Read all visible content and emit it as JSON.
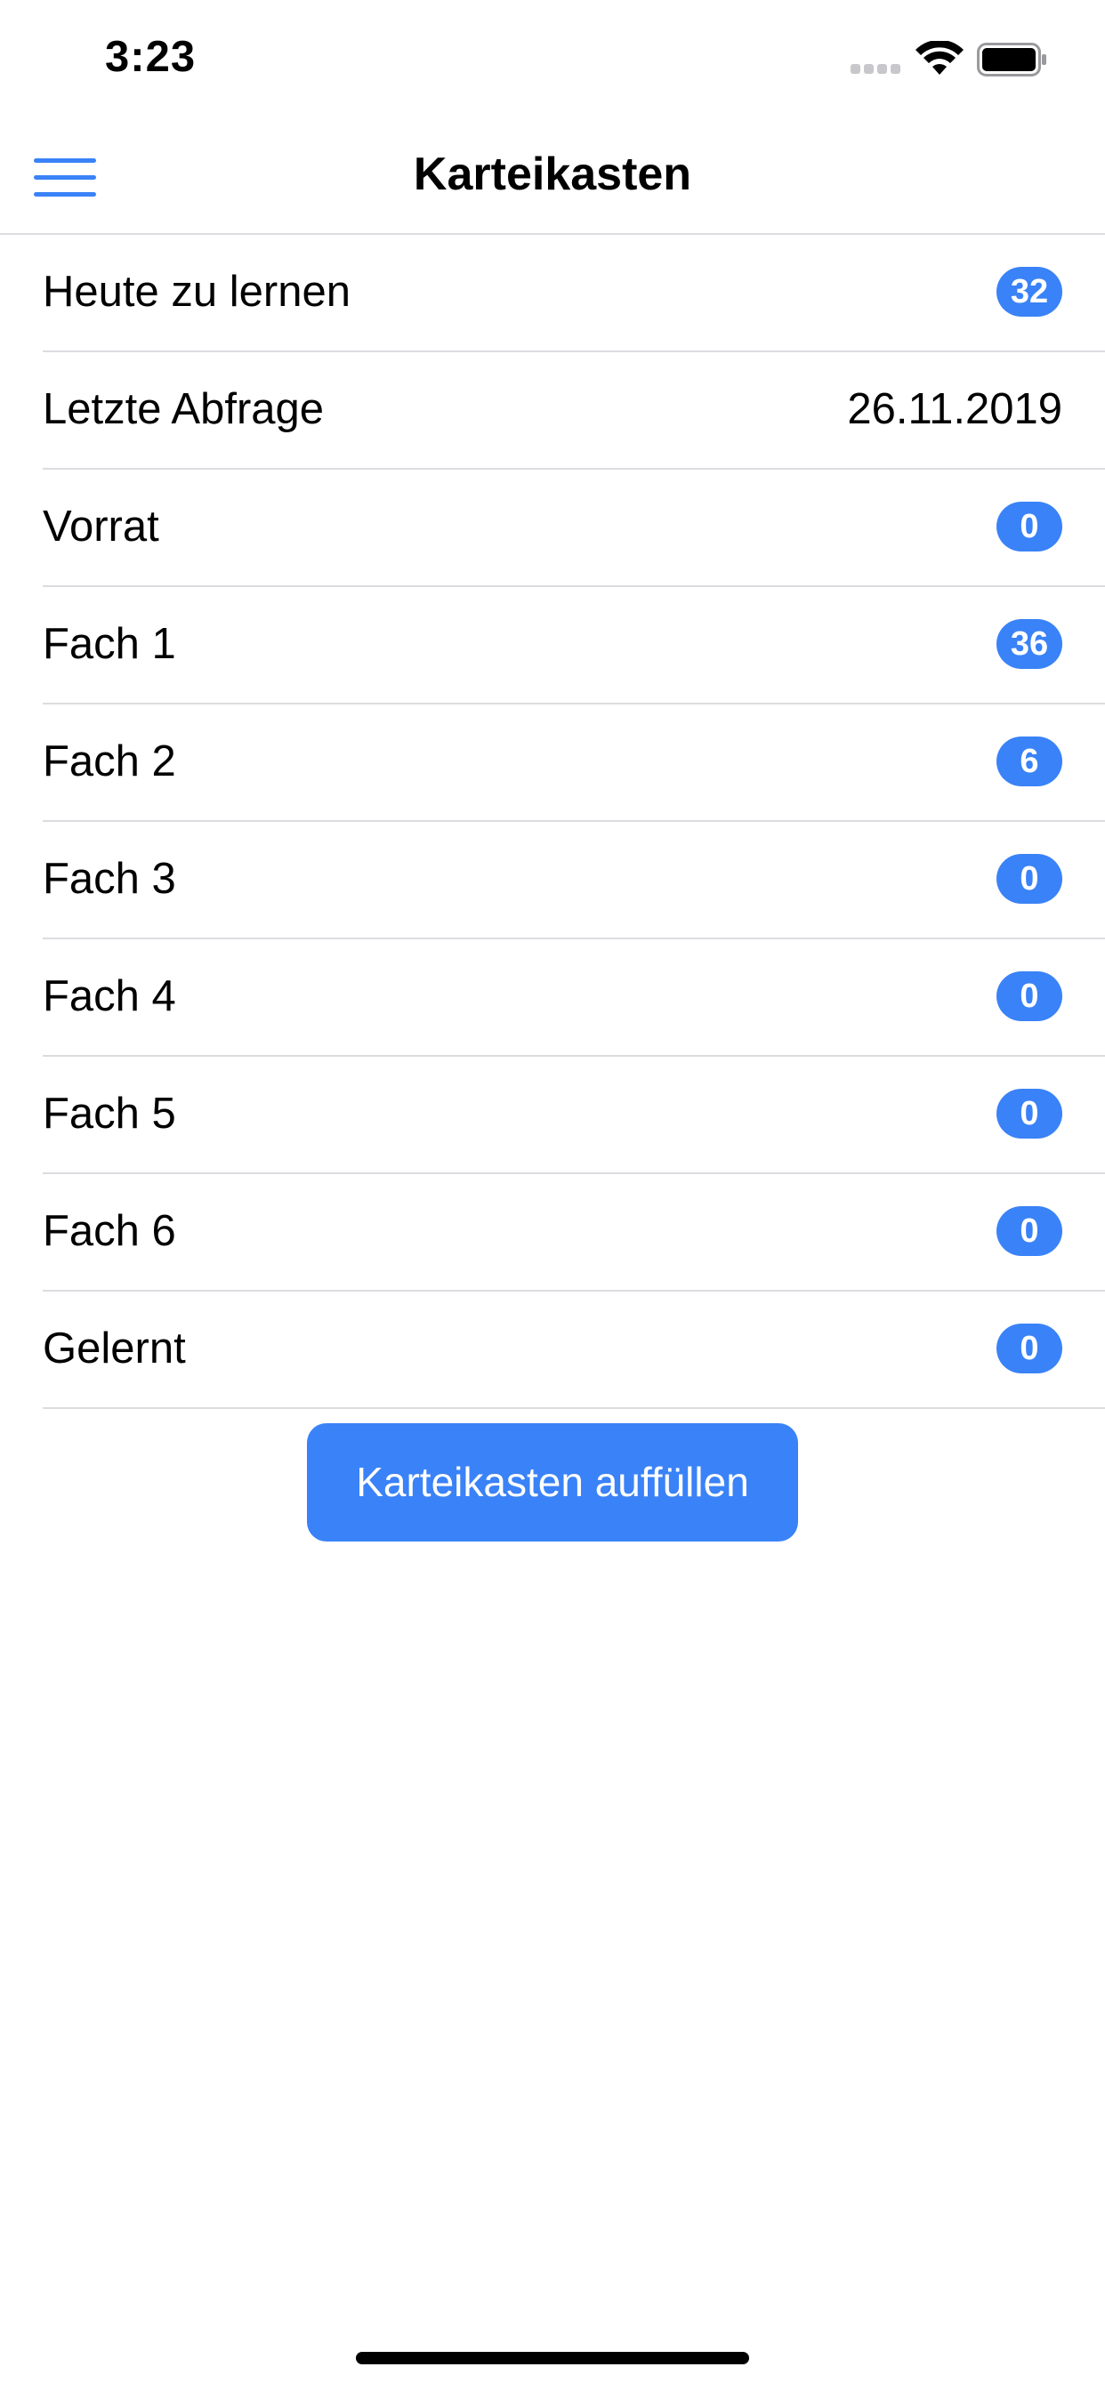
{
  "status_bar": {
    "time": "3:23",
    "icons": [
      "signal-icon",
      "wifi-icon",
      "battery-icon"
    ]
  },
  "nav": {
    "title": "Karteikasten",
    "menu_icon": "hamburger-menu-icon"
  },
  "rows": [
    {
      "label": "Heute zu lernen",
      "badge": "32"
    },
    {
      "label": "Letzte Abfrage",
      "value": "26.11.2019"
    },
    {
      "label": "Vorrat",
      "badge": "0"
    },
    {
      "label": "Fach 1",
      "badge": "36"
    },
    {
      "label": "Fach 2",
      "badge": "6"
    },
    {
      "label": "Fach 3",
      "badge": "0"
    },
    {
      "label": "Fach 4",
      "badge": "0"
    },
    {
      "label": "Fach 5",
      "badge": "0"
    },
    {
      "label": "Fach 6",
      "badge": "0"
    },
    {
      "label": "Gelernt",
      "badge": "0"
    }
  ],
  "button": {
    "label": "Karteikasten auffüllen"
  },
  "colors": {
    "accent": "#3a82f7",
    "separator": "#dcdce0",
    "background": "#ffffff",
    "text": "#000000"
  }
}
